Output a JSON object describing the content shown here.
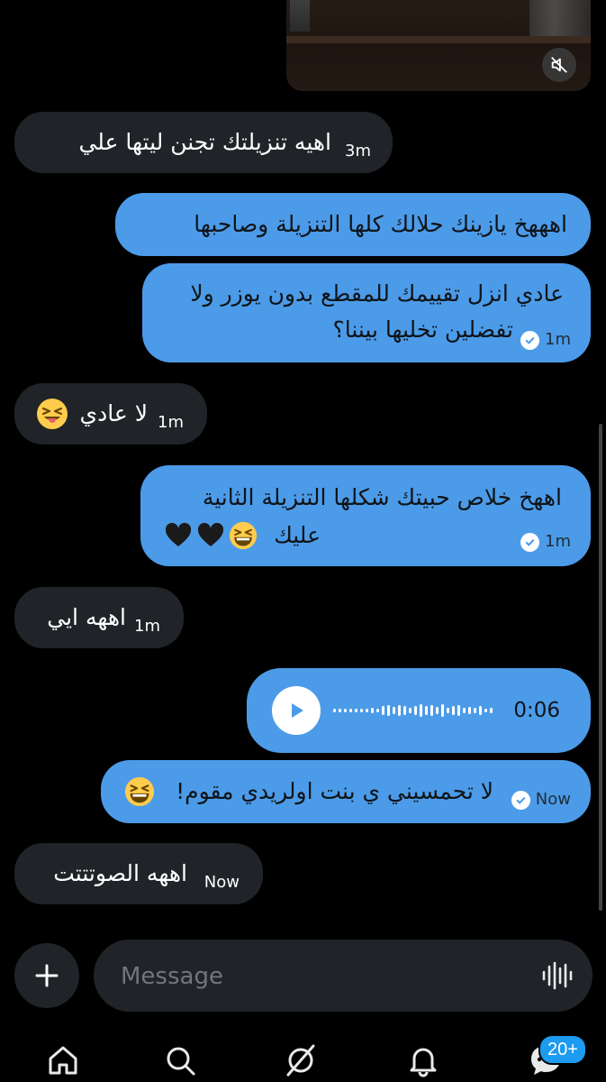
{
  "messages": [
    {
      "id": "m1",
      "direction": "incoming",
      "text": "اهيه تنزيلتك تجنن ليتها علي",
      "time": "3m"
    },
    {
      "id": "m2",
      "direction": "outgoing",
      "text": "اهههخ يازينك حلالك كلها التنزيلة وصاحبها",
      "time": ""
    },
    {
      "id": "m3",
      "direction": "outgoing",
      "line1": "عادي انزل تقييمك للمقطع بدون يوزر ولا",
      "line2": "تفضلين تخليها بيننا؟",
      "time": "1m"
    },
    {
      "id": "m4",
      "direction": "incoming",
      "text": "لا عادي",
      "emoji": "squinting-tongue",
      "time": "1m"
    },
    {
      "id": "m5",
      "direction": "outgoing",
      "line1": "اههخ خلاص حبيتك شكلها التنزيلة الثانية",
      "line2": "عليك",
      "emoji": "grinning-squinting, black-heart, black-heart",
      "time": "1m"
    },
    {
      "id": "m6",
      "direction": "incoming",
      "text": "اههه ايي",
      "time": "1m"
    },
    {
      "id": "m7",
      "direction": "outgoing",
      "type": "voice",
      "duration": "0:06"
    },
    {
      "id": "m8",
      "direction": "outgoing",
      "text": "لا تحمسيني ي بنت اولريدي مقوم!",
      "emoji": "grinning-squinting",
      "time": "Now"
    },
    {
      "id": "m9",
      "direction": "incoming",
      "text": "اههه الصوتتتت",
      "time": "Now"
    }
  ],
  "composer": {
    "placeholder": "Message",
    "add_icon": "plus-icon",
    "voice_icon": "waveform-icon"
  },
  "nav": {
    "items": [
      "home-icon",
      "search-icon",
      "grok-icon",
      "notifications-icon",
      "messages-icon"
    ],
    "badge": "20+"
  },
  "colors": {
    "background": "#000000",
    "incoming_bubble": "#202327",
    "outgoing_bubble": "#4c9be8",
    "badge": "#1d9bf0"
  }
}
